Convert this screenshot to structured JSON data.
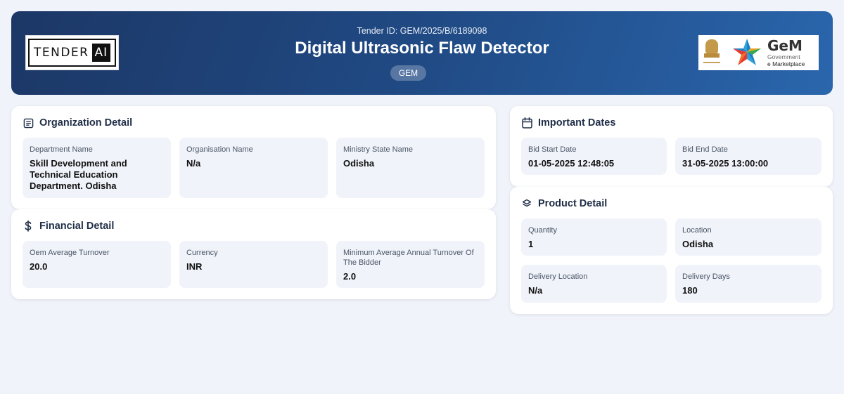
{
  "header": {
    "logo_left_text": "TENDER",
    "logo_left_badge": "AI",
    "tender_id": "Tender ID: GEM/2025/B/6189098",
    "title": "Digital Ultrasonic Flaw Detector",
    "badge": "GEM",
    "logo_right_big": "GeM",
    "logo_right_line1": "Government",
    "logo_right_line2": "e Marketplace"
  },
  "organization": {
    "title": "Organization Detail",
    "icon": "document-icon",
    "fields": [
      {
        "label": "Department Name",
        "value": "Skill Development and Technical Education Department. Odisha"
      },
      {
        "label": "Organisation Name",
        "value": "N/a"
      },
      {
        "label": "Ministry State Name",
        "value": "Odisha"
      }
    ]
  },
  "financial": {
    "title": "Financial Detail",
    "icon": "dollar-icon",
    "fields": [
      {
        "label": "Oem Average Turnover",
        "value": "20.0"
      },
      {
        "label": "Currency",
        "value": "INR"
      },
      {
        "label": "Minimum Average Annual Turnover Of The Bidder",
        "value": "2.0"
      }
    ]
  },
  "dates": {
    "title": "Important Dates",
    "icon": "calendar-icon",
    "fields": [
      {
        "label": "Bid Start Date",
        "value": "01-05-2025 12:48:05"
      },
      {
        "label": "Bid End Date",
        "value": "31-05-2025 13:00:00"
      }
    ]
  },
  "product": {
    "title": "Product Detail",
    "icon": "layers-icon",
    "fields": [
      {
        "label": "Quantity",
        "value": "1"
      },
      {
        "label": "Location",
        "value": "Odisha"
      },
      {
        "label": "Delivery Location",
        "value": "N/a"
      },
      {
        "label": "Delivery Days",
        "value": "180"
      }
    ]
  },
  "colors": {
    "header_start": "#1c3766",
    "header_end": "#2a66ad",
    "background": "#f0f3f9",
    "field_bg": "#f0f3f9"
  }
}
